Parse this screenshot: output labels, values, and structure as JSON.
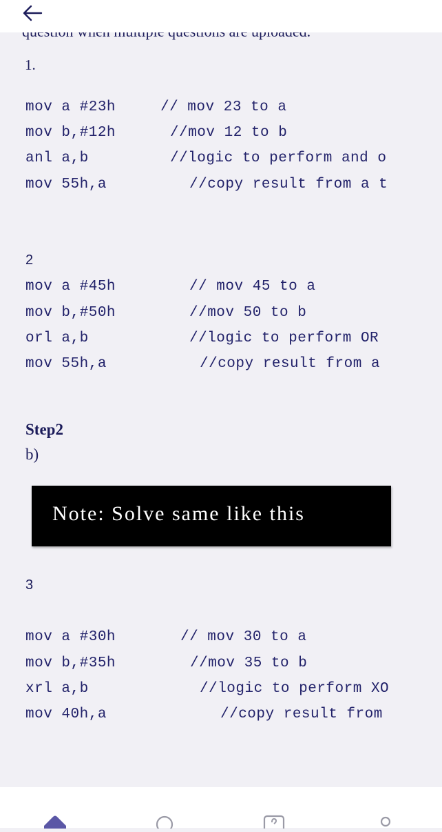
{
  "header": {
    "back_icon": "arrow-left-icon"
  },
  "content": {
    "cut_text": "question when multiple questions are uploaded.",
    "section1": {
      "number": "1.",
      "lines": [
        {
          "code": "mov a #23h",
          "comment": "// mov 23 to a"
        },
        {
          "code": "mov b,#12h",
          "comment": "//mov 12 to b"
        },
        {
          "code": "anl a,b",
          "comment": "//logic to perform and o"
        },
        {
          "code": "mov 55h,a",
          "comment": "//copy result from a t"
        }
      ]
    },
    "section2": {
      "number": "2",
      "lines": [
        {
          "code": "mov a #45h",
          "comment": "// mov 45 to a"
        },
        {
          "code": "mov b,#50h",
          "comment": "//mov 50 to b"
        },
        {
          "code": "orl a,b",
          "comment": "//logic to perform OR"
        },
        {
          "code": "mov 55h,a",
          "comment": "//copy result from a"
        }
      ]
    },
    "step_label": "Step2",
    "sub_label": "b)",
    "note": "Note: Solve same like this",
    "section3": {
      "number": "3",
      "lines": [
        {
          "code": "mov a #30h",
          "comment": "// mov 30 to a"
        },
        {
          "code": "mov b,#35h",
          "comment": "//mov 35 to b"
        },
        {
          "code": "xrl a,b",
          "comment": "//logic to perform XO"
        },
        {
          "code": "mov 40h,a",
          "comment": "//copy result from"
        }
      ]
    }
  },
  "bottom_nav": {
    "items": [
      {
        "icon": "home-icon",
        "active": true
      },
      {
        "icon": "search-icon",
        "active": false
      },
      {
        "icon": "question-icon",
        "active": false
      },
      {
        "icon": "profile-icon",
        "active": false
      }
    ],
    "accent_color": "#5b57a6",
    "inactive_color": "#9a9aa6"
  }
}
